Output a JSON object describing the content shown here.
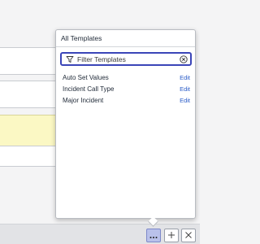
{
  "popover": {
    "title": "All Templates",
    "filter": {
      "placeholder": "Filter Templates",
      "value": ""
    },
    "templates": [
      {
        "name": "Auto Set Values",
        "action": "Edit"
      },
      {
        "name": "Incident Call Type",
        "action": "Edit"
      },
      {
        "name": "Major Incident",
        "action": "Edit"
      }
    ]
  },
  "toolbar": {
    "buttons": [
      {
        "icon": "more-icon"
      },
      {
        "icon": "plus-icon"
      },
      {
        "icon": "close-icon"
      }
    ]
  },
  "colors": {
    "accent": "#3b45b8",
    "link": "#2b5cc8",
    "highlight_field": "#fbf8c4",
    "active_button": "#b9c1ea"
  }
}
